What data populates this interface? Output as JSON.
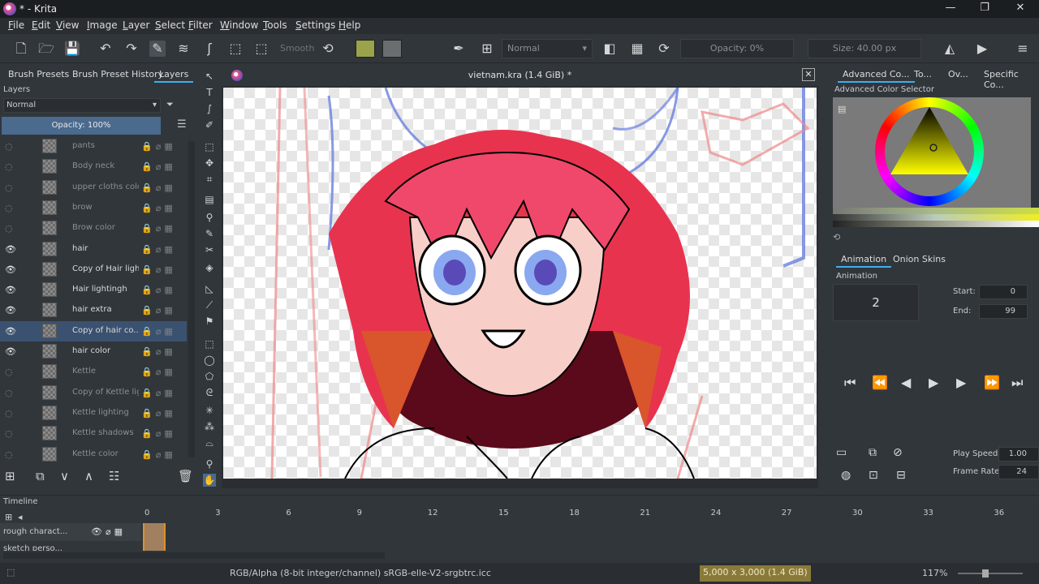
{
  "window": {
    "title": "* - Krita"
  },
  "menu": [
    "File",
    "Edit",
    "View",
    "Image",
    "Layer",
    "Select",
    "Filter",
    "Window",
    "Tools",
    "Settings",
    "Help"
  ],
  "toolbar": {
    "smooth_label": "Smooth",
    "blend_mode": "Normal",
    "opacity": "Opacity: 0%",
    "size": "Size: 40.00 px"
  },
  "left_panel": {
    "tabs": [
      "Brush Presets",
      "Brush Preset History",
      "Layers"
    ],
    "layers_title": "Layers",
    "blend_mode": "Normal",
    "opacity": "Opacity:  100%",
    "layers": [
      {
        "name": "pants",
        "visible": false,
        "selected": false
      },
      {
        "name": "Body neck",
        "visible": false,
        "selected": false
      },
      {
        "name": "upper cloths color",
        "visible": false,
        "selected": false
      },
      {
        "name": "brow",
        "visible": false,
        "selected": false
      },
      {
        "name": "Brow color",
        "visible": false,
        "selected": false
      },
      {
        "name": "hair",
        "visible": true,
        "selected": false
      },
      {
        "name": "Copy of Hair ligh...",
        "visible": true,
        "selected": false
      },
      {
        "name": "Hair lightingh",
        "visible": true,
        "selected": false
      },
      {
        "name": "hair extra",
        "visible": true,
        "selected": false
      },
      {
        "name": "Copy of hair co...",
        "visible": true,
        "selected": true
      },
      {
        "name": "hair color",
        "visible": true,
        "selected": false
      },
      {
        "name": "Kettle",
        "visible": false,
        "selected": false
      },
      {
        "name": "Copy of Kettle lig...",
        "visible": false,
        "selected": false
      },
      {
        "name": "Kettle lighting",
        "visible": false,
        "selected": false
      },
      {
        "name": "Kettle shadows",
        "visible": false,
        "selected": false
      },
      {
        "name": "Kettle color",
        "visible": false,
        "selected": false
      }
    ]
  },
  "document": {
    "title": "vietnam.kra (1.4 GiB) *"
  },
  "right_panel": {
    "tabs": [
      "Advanced Co...",
      "To...",
      "Ov...",
      "Specific Co..."
    ],
    "color_selector_title": "Advanced Color Selector",
    "anim_tabs": [
      "Animation",
      "Onion Skins"
    ],
    "animation_title": "Animation",
    "current_frame": "2",
    "start_label": "Start:",
    "start_value": "0",
    "end_label": "End:",
    "end_value": "99",
    "play_speed_label": "Play Speed:",
    "play_speed_value": "1.00",
    "frame_rate_label": "Frame Rate:",
    "frame_rate_value": "24"
  },
  "timeline": {
    "title": "Timeline",
    "frames": [
      "0",
      "3",
      "6",
      "9",
      "12",
      "15",
      "18",
      "21",
      "24",
      "27",
      "30",
      "33",
      "36"
    ],
    "layers": [
      "rough charact...",
      "sketch perso..."
    ]
  },
  "status": {
    "color_space": "RGB/Alpha (8-bit integer/channel)  sRGB-elle-V2-srgbtrc.icc",
    "dimensions": "5,000 x 3,000 (1.4 GiB)",
    "zoom": "117%"
  },
  "colors": {
    "accent": "#3daee9",
    "selection": "#3a5270",
    "fg_swatch": "#9aa34a",
    "bg_swatch": "#6b6e70"
  }
}
